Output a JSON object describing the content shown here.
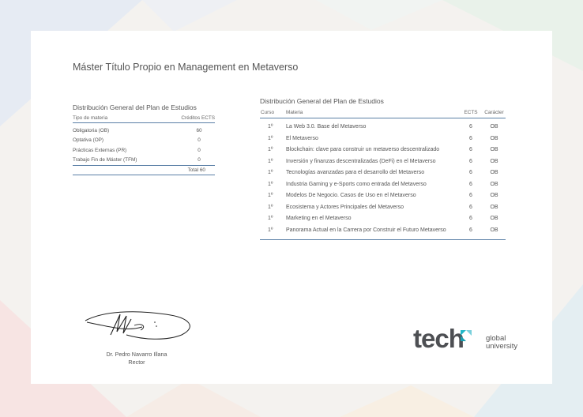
{
  "title": "Máster Título Propio en Management en Metaverso",
  "summary": {
    "heading": "Distribución General del Plan de Estudios",
    "col_type": "Tipo de materia",
    "col_credits": "Créditos ECTS",
    "rows": [
      {
        "label": "Obligatoria (OB)",
        "value": "60"
      },
      {
        "label": "Optativa (OP)",
        "value": "0"
      },
      {
        "label": "Prácticas Externas (PR)",
        "value": "0"
      },
      {
        "label": "Trabajo Fin de Máster (TFM)",
        "value": "0"
      }
    ],
    "total": "Total 60"
  },
  "courses": {
    "heading": "Distribución General del Plan de Estudios",
    "col_curso": "Curso",
    "col_materia": "Materia",
    "col_ects": "ECTS",
    "col_caracter": "Carácter",
    "rows": [
      {
        "curso": "1º",
        "materia": "La Web 3.0. Base del Metaverso",
        "ects": "6",
        "caracter": "OB"
      },
      {
        "curso": "1º",
        "materia": "El Metaverso",
        "ects": "6",
        "caracter": "OB"
      },
      {
        "curso": "1º",
        "materia": "Blockchain: clave para construir un metaverso descentralizado",
        "ects": "6",
        "caracter": "OB"
      },
      {
        "curso": "1º",
        "materia": "Inversión y finanzas descentralizadas (DeFi) en el Metaverso",
        "ects": "6",
        "caracter": "OB"
      },
      {
        "curso": "1º",
        "materia": "Tecnologías avanzadas para el desarrollo del Metaverso",
        "ects": "6",
        "caracter": "OB"
      },
      {
        "curso": "1º",
        "materia": "Industria Gaming y e-Sports como entrada del Metaverso",
        "ects": "6",
        "caracter": "OB"
      },
      {
        "curso": "1º",
        "materia": "Modelos De Negocio. Casos de Uso en el Metaverso",
        "ects": "6",
        "caracter": "OB"
      },
      {
        "curso": "1º",
        "materia": "Ecosistema y Actores Principales del Metaverso",
        "ects": "6",
        "caracter": "OB"
      },
      {
        "curso": "1º",
        "materia": "Marketing en el Metaverso",
        "ects": "6",
        "caracter": "OB"
      },
      {
        "curso": "1º",
        "materia": "Panorama Actual en la Carrera por Construir el Futuro Metaverso",
        "ects": "6",
        "caracter": "OB"
      }
    ]
  },
  "signer": {
    "name": "Dr. Pedro Navarro Illana",
    "role": "Rector"
  },
  "logo": {
    "word": "tech",
    "line1": "global",
    "line2": "university",
    "accent": "#22b8c8"
  }
}
